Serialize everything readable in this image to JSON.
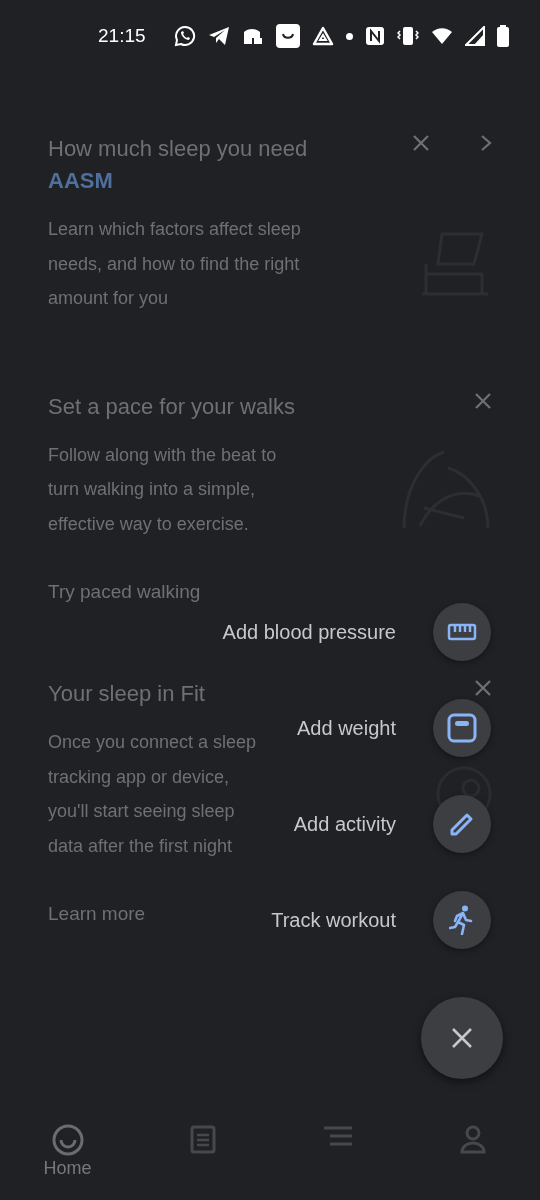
{
  "status_bar": {
    "time": "21:15"
  },
  "cards": [
    {
      "title": "How much sleep you need",
      "logo": "AASM",
      "body": "Learn which factors affect sleep needs, and how to find the right amount for you",
      "has_chevron": true
    },
    {
      "title": "Set a pace for your walks",
      "body": "Follow along with the beat to turn walking into a simple, effective way to exercise.",
      "link": "Try paced walking",
      "has_chevron": false
    },
    {
      "title": "Your sleep in Fit",
      "body": "Once you connect a sleep tracking app or device, you'll start seeing sleep data after the first night",
      "link": "Learn more",
      "has_chevron": false
    }
  ],
  "fab_menu": {
    "actions": [
      {
        "label": "Add blood pressure",
        "kind": "blood_pressure"
      },
      {
        "label": "Add weight",
        "kind": "weight"
      },
      {
        "label": "Add activity",
        "kind": "activity"
      },
      {
        "label": "Track workout",
        "kind": "workout"
      }
    ]
  },
  "bottom_nav": [
    {
      "kind": "home",
      "label": "Home",
      "selected": true
    },
    {
      "kind": "journal",
      "selected": false
    },
    {
      "kind": "browse",
      "selected": false
    },
    {
      "kind": "profile",
      "selected": false
    }
  ]
}
